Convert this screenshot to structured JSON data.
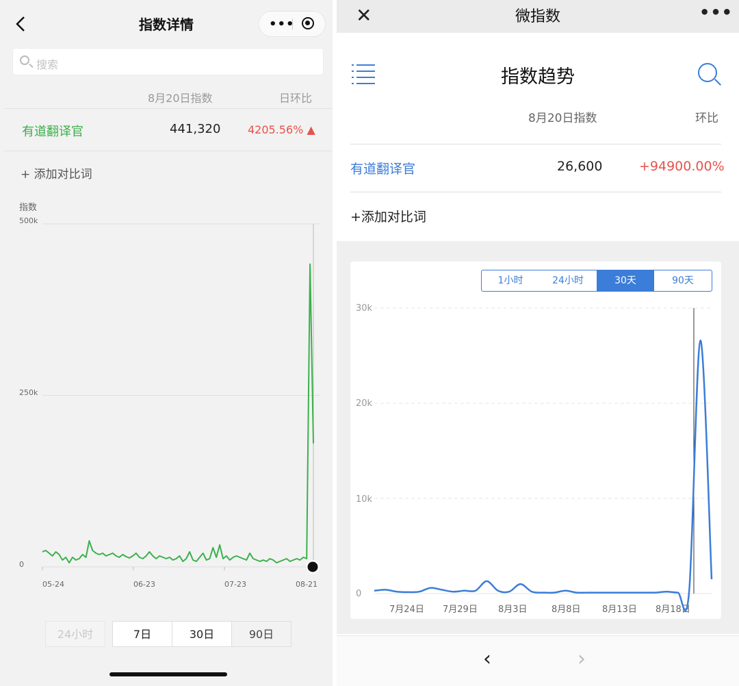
{
  "left": {
    "nav": {
      "title": "指数详情",
      "more": "•••"
    },
    "search": {
      "placeholder": "搜索"
    },
    "table": {
      "header_index": "8月20日指数",
      "header_change": "日环比",
      "row": {
        "name": "有道翻译官",
        "value": "441,320",
        "change": "4205.56% ▲"
      }
    },
    "add_compare": "+ 添加对比词",
    "chart_data": {
      "type": "line",
      "ylabel": "指数",
      "y_ticks": [
        "500k",
        "250k",
        "0"
      ],
      "x_ticks": [
        "05-24",
        "06-23",
        "07-23",
        "08-21"
      ],
      "ylim": [
        0,
        500000
      ],
      "series": [
        {
          "values": [
            22000,
            24000,
            20000,
            16000,
            22000,
            18000,
            10000,
            14000,
            6000,
            14000,
            10000,
            12000,
            18000,
            14000,
            38000,
            24000,
            20000,
            18000,
            20000,
            16000,
            18000,
            20000,
            16000,
            14000,
            18000,
            15000,
            13000,
            16000,
            20000,
            14000,
            12000,
            16000,
            22000,
            16000,
            12000,
            16000,
            14000,
            12000,
            14000,
            10000,
            12000,
            16000,
            8000,
            12000,
            22000,
            10000,
            8000,
            14000,
            20000,
            10000,
            12000,
            28000,
            14000,
            32000,
            12000,
            16000,
            10000,
            14000,
            16000,
            14000,
            12000,
            10000,
            20000,
            12000,
            10000,
            8000,
            10000,
            8000,
            12000,
            10000,
            6000,
            8000,
            10000,
            12000,
            8000,
            10000,
            12000,
            10000,
            14000,
            12000,
            441320,
            180000
          ],
          "color": "#3bb04b"
        }
      ]
    },
    "range_buttons": [
      "24小时",
      "7日",
      "30日",
      "90日"
    ]
  },
  "right": {
    "nav": {
      "close": "✕",
      "title": "微指数",
      "more": "•••"
    },
    "header_title": "指数趋势",
    "table": {
      "header_index": "8月20日指数",
      "header_change": "环比",
      "row": {
        "name": "有道翻译官",
        "value": "26,600",
        "change": "+94900.00%"
      }
    },
    "add_compare": "+添加对比词",
    "segments": [
      "1小时",
      "24小时",
      "30天",
      "90天"
    ],
    "active_segment": "30天",
    "chart_data": {
      "type": "line",
      "y_ticks": [
        "30k",
        "20k",
        "10k",
        "0"
      ],
      "x_ticks": [
        "7月24日",
        "7月29日",
        "8月3日",
        "8月8日",
        "8月13日",
        "8月18日"
      ],
      "ylim": [
        0,
        30000
      ],
      "series": [
        {
          "values": [
            300,
            400,
            200,
            150,
            200,
            600,
            400,
            200,
            300,
            300,
            1300,
            300,
            200,
            1000,
            200,
            100,
            100,
            300,
            100,
            100,
            100,
            100,
            100,
            100,
            100,
            100,
            200,
            100,
            200,
            26600,
            1500
          ],
          "color": "#3b7dd8"
        }
      ]
    },
    "bottom_nav": {
      "prev": "‹",
      "next": "›"
    }
  }
}
